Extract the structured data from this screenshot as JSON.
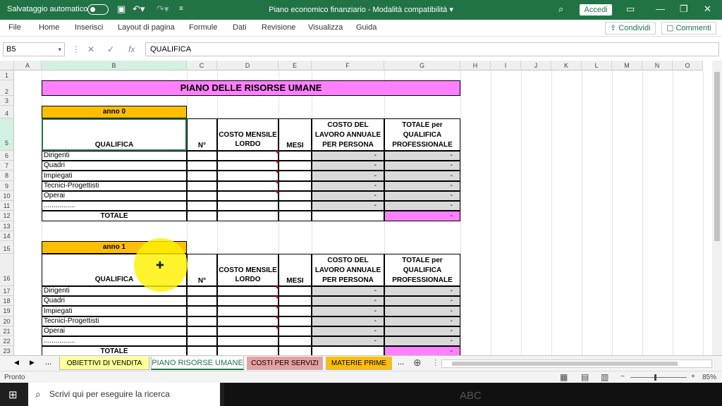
{
  "titlebar": {
    "autosave": "Salvataggio automatico",
    "doc_title": "Piano economico finanziario  -  Modalità compatibilità  ▾",
    "signin": "Accedi"
  },
  "menu": [
    "File",
    "Home",
    "Inserisci",
    "Layout di pagina",
    "Formule",
    "Dati",
    "Revisione",
    "Visualizza",
    "Guida"
  ],
  "share": {
    "share_label": "Condividi",
    "comments_label": "Commenti"
  },
  "formulabar": {
    "namebox": "B5",
    "value": "QUALIFICA"
  },
  "columns": [
    "A",
    "B",
    "C",
    "D",
    "E",
    "F",
    "G",
    "H",
    "I",
    "J",
    "K",
    "L",
    "M",
    "N",
    "O"
  ],
  "rows": [
    "1",
    "2",
    "3",
    "4",
    "5",
    "6",
    "7",
    "8",
    "9",
    "10",
    "11",
    "12",
    "13",
    "14",
    "15",
    "16",
    "17",
    "18",
    "19",
    "20",
    "21",
    "22",
    "23"
  ],
  "sheet": {
    "title": "PIANO DELLE RISORSE UMANE",
    "blocks": [
      {
        "year": "anno 0",
        "h_qualifica": "QUALIFICA",
        "h_n": "N°",
        "h_costo": "COSTO MENSILE LORDO",
        "h_mesi": "MESI",
        "h_costo_annuo": "COSTO DEL LAVORO ANNUALE PER PERSONA",
        "h_totale": "TOTALE per QUALIFICA PROFESSIONALE",
        "roles": [
          "Dirigenti",
          "Quadri",
          "Impiegati",
          "Tecnici-Progettisti",
          "Operai",
          "................"
        ],
        "dash": "-",
        "totale": "TOTALE"
      },
      {
        "year": "anno 1",
        "h_qualifica": "QUALIFICA",
        "h_n": "N°",
        "h_costo": "COSTO MENSILE LORDO",
        "h_mesi": "MESI",
        "h_costo_annuo": "COSTO DEL LAVORO ANNUALE PER PERSONA",
        "h_totale": "TOTALE per QUALIFICA PROFESSIONALE",
        "roles": [
          "Dirigenti",
          "Quadri",
          "Impiegati",
          "Tecnici-Progettisti",
          "Operai",
          "................"
        ],
        "dash": "-",
        "totale": "TOTALE"
      }
    ]
  },
  "tabs": {
    "ellipsis": "...",
    "items": [
      {
        "label": "OBIETTIVI DI VENDITA",
        "color": "#ffff99"
      },
      {
        "label": "PIANO RISORSE UMANE",
        "color": "#ffffff",
        "active": true
      },
      {
        "label": "COSTI PER SERVIZI",
        "color": "#e6a0a0"
      },
      {
        "label": "MATERIE PRIME",
        "color": "#ffbf00"
      }
    ],
    "add": "⊕"
  },
  "status": {
    "ready": "Pronto",
    "zoom": "85%"
  },
  "taskbar": {
    "search_placeholder": "Scrivi qui per eseguire la ricerca",
    "caption": "ABC"
  },
  "colors": {
    "header_green": "#217346",
    "title_fill": "#ff80ff",
    "year_fill": "#ffbf00",
    "formula_fill": "#d9d9d9"
  }
}
